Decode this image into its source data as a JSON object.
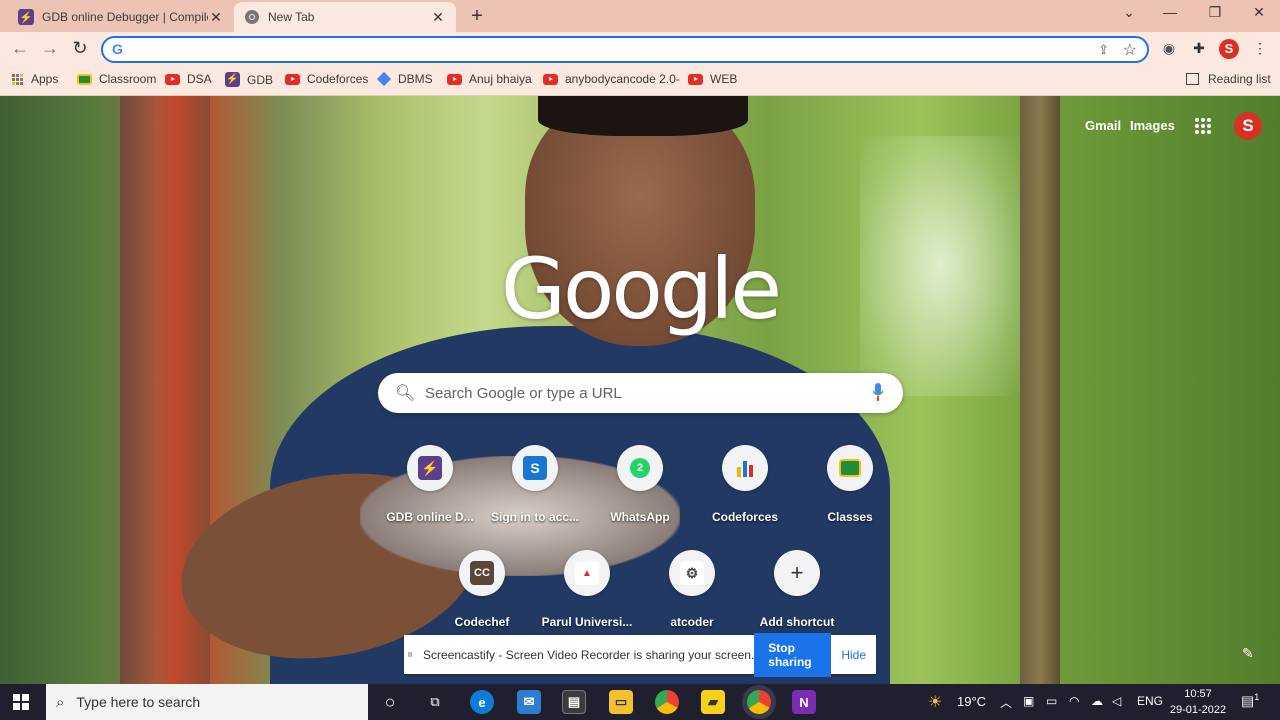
{
  "browser": {
    "tabs": [
      {
        "title": "GDB online Debugger | Compiler",
        "active": false
      },
      {
        "title": "New Tab",
        "active": true
      }
    ],
    "omnibox_value": "",
    "bookmarks": [
      {
        "label": "Apps",
        "icon": "apps-grid-icon"
      },
      {
        "label": "Classroom",
        "icon": "classroom-icon"
      },
      {
        "label": "DSA",
        "icon": "youtube-icon"
      },
      {
        "label": "GDB",
        "icon": "gdb-icon"
      },
      {
        "label": "Codeforces",
        "icon": "youtube-icon"
      },
      {
        "label": "DBMS",
        "icon": "diamond-icon"
      },
      {
        "label": "Anuj bhaiya",
        "icon": "youtube-icon"
      },
      {
        "label": "anybodycancode 2.0-",
        "icon": "youtube-icon"
      },
      {
        "label": "WEB",
        "icon": "youtube-icon"
      }
    ],
    "reading_list": "Reading list",
    "profile_initial": "S"
  },
  "newtab": {
    "gmail": "Gmail",
    "images": "Images",
    "profile_initial": "S",
    "logo": "Google",
    "search_placeholder": "Search Google or type a URL",
    "shortcuts_row1": [
      {
        "label": "GDB online D...",
        "icon": "gdb-icon",
        "color": "#5b3f8c"
      },
      {
        "label": "Sign in to acc...",
        "icon": "s-icon",
        "color": "#1976d2"
      },
      {
        "label": "WhatsApp",
        "icon": "whatsapp-icon",
        "color": "#25d366"
      },
      {
        "label": "Codeforces",
        "icon": "codeforces-icon",
        "color": "#f4b400"
      },
      {
        "label": "Classes",
        "icon": "classroom-icon",
        "color": "#1e8e3e"
      }
    ],
    "shortcuts_row2": [
      {
        "label": "Codechef",
        "icon": "codechef-icon",
        "color": "#5b4638"
      },
      {
        "label": "Parul Universi...",
        "icon": "parul-icon",
        "color": "#d93025"
      },
      {
        "label": "atcoder",
        "icon": "atcoder-icon",
        "color": "#444444"
      },
      {
        "label": "Add shortcut",
        "icon": "plus-icon",
        "color": "#333333"
      }
    ]
  },
  "screencastify": {
    "message": "Screencastify - Screen Video Recorder is sharing your screen.",
    "stop": "Stop sharing",
    "hide": "Hide"
  },
  "taskbar": {
    "search_placeholder": "Type here to search",
    "temperature": "19°C",
    "language": "ENG",
    "time": "10:57",
    "date": "29-01-2022",
    "notifications": "1"
  }
}
